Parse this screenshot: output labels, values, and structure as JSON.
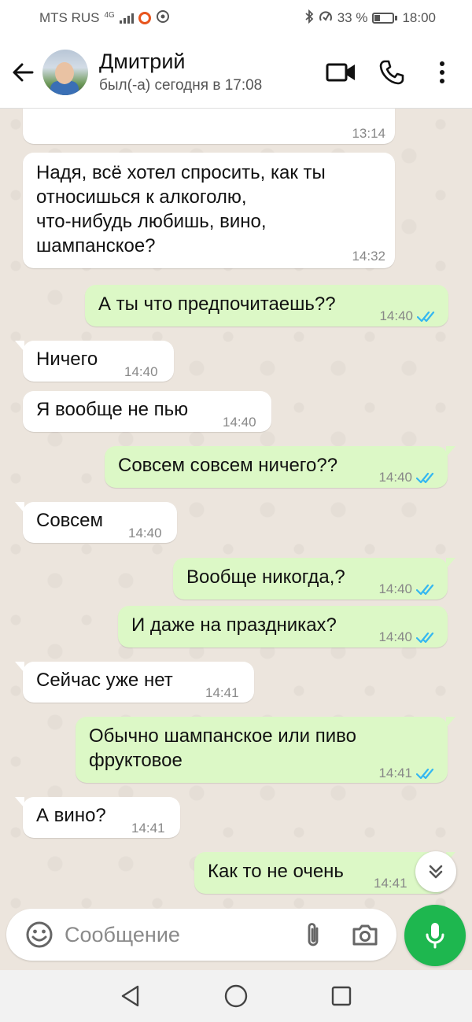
{
  "status_bar": {
    "carrier": "MTS RUS",
    "network": "4G",
    "bluetooth_icon": "bluetooth-icon",
    "battery_percent": "33 %",
    "battery_level": 0.33,
    "time": "18:00"
  },
  "header": {
    "contact_name": "Дмитрий",
    "last_seen": "был(-а) сегодня в 17:08",
    "icons": [
      "back-arrow-icon",
      "video-call-icon",
      "phone-icon",
      "more-vert-icon"
    ]
  },
  "messages": [
    {
      "dir": "in",
      "lines": [
        ""
      ],
      "time": "13:14"
    },
    {
      "dir": "in",
      "lines": [
        "Надя, всё хотел спросить, как ты",
        "относишься к алкоголю,",
        "что-нибудь любишь, вино,",
        "шампанское?"
      ],
      "time": "14:32"
    },
    {
      "dir": "out",
      "lines": [
        "А ты что предпочитаешь??"
      ],
      "time": "14:40",
      "read": true
    },
    {
      "dir": "in",
      "lines": [
        "Ничего"
      ],
      "time": "14:40"
    },
    {
      "dir": "in",
      "lines": [
        "Я вообще не пью"
      ],
      "time": "14:40"
    },
    {
      "dir": "out",
      "lines": [
        "Совсем совсем ничего??"
      ],
      "time": "14:40",
      "read": true
    },
    {
      "dir": "in",
      "lines": [
        "Совсем"
      ],
      "time": "14:40"
    },
    {
      "dir": "out",
      "lines": [
        "Вообще никогда,?"
      ],
      "time": "14:40",
      "read": true
    },
    {
      "dir": "out",
      "lines": [
        "И даже на праздниках?"
      ],
      "time": "14:40",
      "read": true
    },
    {
      "dir": "in",
      "lines": [
        "Сейчас уже нет"
      ],
      "time": "14:41"
    },
    {
      "dir": "out",
      "lines": [
        "Обычно шампанское или пиво",
        "фруктовое"
      ],
      "time": "14:41",
      "read": true
    },
    {
      "dir": "in",
      "lines": [
        "А вино?"
      ],
      "time": "14:41"
    },
    {
      "dir": "out",
      "lines": [
        "Как то не очень"
      ],
      "time": "14:41",
      "read": true
    }
  ],
  "input": {
    "placeholder": "Сообщение",
    "value": ""
  },
  "colors": {
    "outgoing_bubble": "#dcf8c6",
    "incoming_bubble": "#ffffff",
    "chat_background": "#ece5dd",
    "read_ticks": "#34b7f1",
    "mic_button": "#1eb74f"
  }
}
